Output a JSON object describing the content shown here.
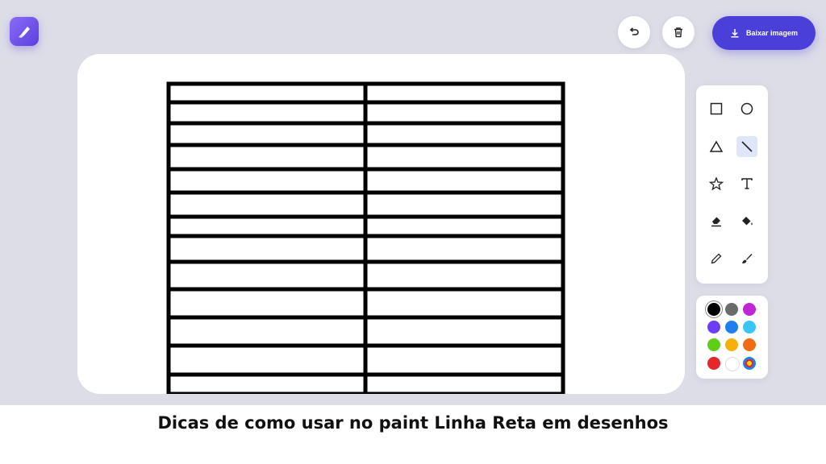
{
  "toolbar": {
    "download_label": "Baixar imagem"
  },
  "tools": [
    {
      "name": "square-tool",
      "icon": "square-icon",
      "active": false
    },
    {
      "name": "circle-tool",
      "icon": "circle-icon",
      "active": false
    },
    {
      "name": "triangle-tool",
      "icon": "triangle-icon",
      "active": false
    },
    {
      "name": "line-tool",
      "icon": "line-icon",
      "active": true
    },
    {
      "name": "star-tool",
      "icon": "star-icon",
      "active": false
    },
    {
      "name": "text-tool",
      "icon": "text-icon",
      "active": false
    },
    {
      "name": "eraser-tool",
      "icon": "eraser-icon",
      "active": false
    },
    {
      "name": "fill-tool",
      "icon": "fill-bucket-icon",
      "active": false
    },
    {
      "name": "pencil-tool",
      "icon": "pencil-icon",
      "active": false
    },
    {
      "name": "brush-tool",
      "icon": "brush-icon",
      "active": false
    }
  ],
  "palette": {
    "selected": "#000000",
    "colors": [
      "#000000",
      "#6b6b6b",
      "#c026d3",
      "#6d3df5",
      "#1f7ff0",
      "#38c4f5",
      "#5ccf16",
      "#f5b00a",
      "#f06b15",
      "#e5262a",
      "#ffffff",
      "rainbow"
    ]
  },
  "caption": "Dicas de como usar no paint Linha Reta em desenhos"
}
